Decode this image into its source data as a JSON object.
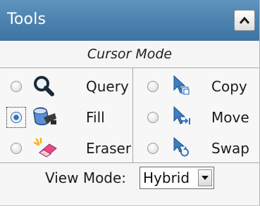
{
  "panel": {
    "title": "Tools",
    "collapse_icon": "chevron-up-icon"
  },
  "cursor_mode": {
    "label": "Cursor Mode",
    "left_options": [
      {
        "label": "Query",
        "icon": "magnifier-icon",
        "selected": false
      },
      {
        "label": "Fill",
        "icon": "paint-bucket-icon",
        "selected": true
      },
      {
        "label": "Eraser",
        "icon": "eraser-icon",
        "selected": false
      }
    ],
    "right_options": [
      {
        "label": "Copy",
        "icon": "copy-cursor-icon",
        "selected": false
      },
      {
        "label": "Move",
        "icon": "move-cursor-icon",
        "selected": false
      },
      {
        "label": "Swap",
        "icon": "swap-cursor-icon",
        "selected": false
      }
    ]
  },
  "view_mode": {
    "label": "View Mode:",
    "selected": "Hybrid"
  },
  "colors": {
    "titlebar": "#4a80ad",
    "radio_selected": "#1a5fae"
  }
}
